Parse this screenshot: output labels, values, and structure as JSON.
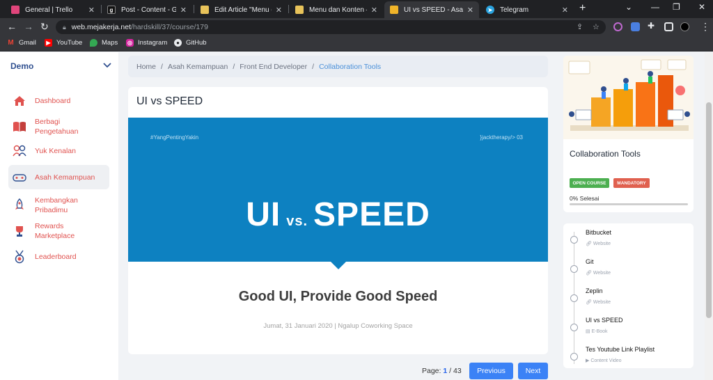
{
  "browser": {
    "tabs": [
      {
        "title": "General | Trello",
        "active": false
      },
      {
        "title": "Post - Content - Graph",
        "active": false
      },
      {
        "title": "Edit Article \"Menu dan",
        "active": false
      },
      {
        "title": "Menu dan Konten – M",
        "active": false
      },
      {
        "title": "UI vs SPEED - Asah Ke",
        "active": true
      },
      {
        "title": "Telegram",
        "active": false
      }
    ],
    "new_tab": "+",
    "url_host": "web.mejakerja.net",
    "url_path": "/hardskill/37/course/179",
    "bookmarks": [
      "Gmail",
      "YouTube",
      "Maps",
      "Instagram",
      "GitHub"
    ]
  },
  "sidebar": {
    "brand": "Demo",
    "items": [
      {
        "label": "Dashboard",
        "icon": "home-icon"
      },
      {
        "label": "Berbagi Pengetahuan",
        "icon": "book-icon"
      },
      {
        "label": "Yuk Kenalan",
        "icon": "people-icon"
      },
      {
        "label": "Asah Kemampuan",
        "icon": "gamepad-icon"
      },
      {
        "label": "Kembangkan Pribadimu",
        "icon": "rocket-icon"
      },
      {
        "label": "Rewards Marketplace",
        "icon": "trophy-icon"
      },
      {
        "label": "Leaderboard",
        "icon": "medal-icon"
      }
    ]
  },
  "breadcrumb": {
    "items": [
      "Home",
      "Asah Kemampuan",
      "Front End Developer"
    ],
    "current": "Collaboration Tools",
    "separator": "/"
  },
  "content": {
    "title": "UI vs SPEED",
    "slide": {
      "hashtag": "#YangPentingYakin",
      "tag": "}jacktherapy/> 03",
      "big_left": "UI",
      "big_vs": "vs.",
      "big_right": "SPEED",
      "heading": "Good UI, Provide Good Speed",
      "subtitle": "Jumat, 31 Januari 2020 | Ngalup Coworking Space"
    }
  },
  "pager": {
    "label": "Page:",
    "current": "1",
    "sep": "/",
    "total": "43",
    "previous": "Previous",
    "next": "Next"
  },
  "course": {
    "title": "Collaboration Tools",
    "badge_open": "OPEN COURSE",
    "badge_mandatory": "MANDATORY",
    "progress_label": "0% Selesai",
    "progress_value": 0
  },
  "lessons": [
    {
      "name": "Bitbucket",
      "type": "Website"
    },
    {
      "name": "Git",
      "type": "Website"
    },
    {
      "name": "Zeplin",
      "type": "Website"
    },
    {
      "name": "UI vs SPEED",
      "type": "E-Book"
    },
    {
      "name": "Tes Youtube Link Playlist",
      "type": "Content Video"
    }
  ],
  "colors": {
    "accent": "#e0524f",
    "brand": "#2f4f8f",
    "banner": "#0d81c1",
    "button": "#3b82f6",
    "badge_open": "#4caf50",
    "badge_mandatory": "#e0604f"
  }
}
